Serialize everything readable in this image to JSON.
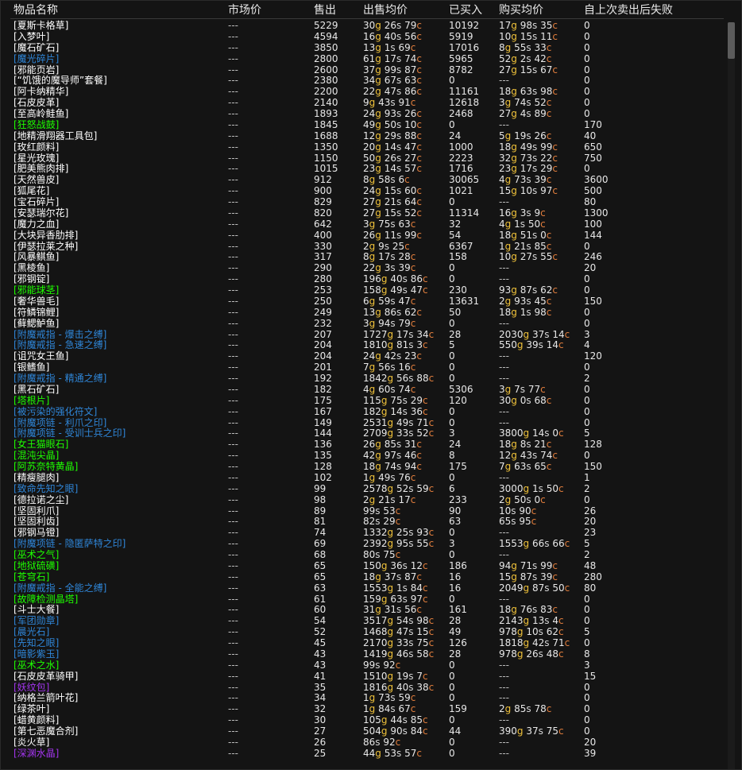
{
  "colors": {
    "white": "#ffffff",
    "blue": "#2f86d8",
    "green": "#1eff00",
    "purple": "#a335ee",
    "gold": "#f0c23a",
    "silver": "#d6d6d6",
    "copper": "#e07d3c"
  },
  "headers": [
    "物品名称",
    "市场价",
    "售出",
    "出售均价",
    "已买入",
    "购买均价",
    "自上次卖出后失败"
  ],
  "rows": [
    {
      "name": "[夏斯卡格草]",
      "q": "white",
      "mkt": "---",
      "sold": "5229",
      "sell": {
        "g": "30",
        "s": "26",
        "c": "79"
      },
      "bought": "10192",
      "buy": {
        "g": "17",
        "s": "98",
        "c": "35"
      },
      "fail": "0"
    },
    {
      "name": "[入梦叶]",
      "q": "white",
      "mkt": "---",
      "sold": "4594",
      "sell": {
        "g": "16",
        "s": "40",
        "c": "56"
      },
      "bought": "5919",
      "buy": {
        "g": "10",
        "s": "15",
        "c": "11"
      },
      "fail": "0"
    },
    {
      "name": "[魔石矿石]",
      "q": "white",
      "mkt": "---",
      "sold": "3850",
      "sell": {
        "g": "13",
        "s": "1",
        "c": "69"
      },
      "bought": "17016",
      "buy": {
        "g": "8",
        "s": "55",
        "c": "33"
      },
      "fail": "0"
    },
    {
      "name": "[魔光碎片]",
      "q": "blue",
      "mkt": "---",
      "sold": "2800",
      "sell": {
        "g": "61",
        "s": "17",
        "c": "74"
      },
      "bought": "5965",
      "buy": {
        "g": "52",
        "s": "2",
        "c": "42"
      },
      "fail": "0"
    },
    {
      "name": "[邪能页岩]",
      "q": "white",
      "mkt": "---",
      "sold": "2600",
      "sell": {
        "g": "37",
        "s": "99",
        "c": "87"
      },
      "bought": "8782",
      "buy": {
        "g": "27",
        "s": "15",
        "c": "67"
      },
      "fail": "0"
    },
    {
      "name": "[“饥饿的魔导师”套餐]",
      "q": "white",
      "mkt": "---",
      "sold": "2380",
      "sell": {
        "g": "34",
        "s": "67",
        "c": "63"
      },
      "bought": "0",
      "buy": null,
      "fail": "0"
    },
    {
      "name": "[阿卡纳精华]",
      "q": "white",
      "mkt": "---",
      "sold": "2200",
      "sell": {
        "g": "22",
        "s": "47",
        "c": "86"
      },
      "bought": "11161",
      "buy": {
        "g": "18",
        "s": "63",
        "c": "98"
      },
      "fail": "0"
    },
    {
      "name": "[石皮皮革]",
      "q": "white",
      "mkt": "---",
      "sold": "2140",
      "sell": {
        "g": "9",
        "s": "43",
        "c": "91"
      },
      "bought": "12618",
      "buy": {
        "g": "3",
        "s": "74",
        "c": "52"
      },
      "fail": "0"
    },
    {
      "name": "[至高岭鲑鱼]",
      "q": "white",
      "mkt": "---",
      "sold": "1893",
      "sell": {
        "g": "24",
        "s": "93",
        "c": "26"
      },
      "bought": "2468",
      "buy": {
        "g": "27",
        "s": "4",
        "c": "89"
      },
      "fail": "0"
    },
    {
      "name": "[狂怒战鼓]",
      "q": "green",
      "mkt": "---",
      "sold": "1845",
      "sell": {
        "g": "49",
        "s": "50",
        "c": "10"
      },
      "bought": "0",
      "buy": null,
      "fail": "170"
    },
    {
      "name": "[地精滑翔器工具包]",
      "q": "white",
      "mkt": "---",
      "sold": "1688",
      "sell": {
        "g": "12",
        "s": "29",
        "c": "88"
      },
      "bought": "24",
      "buy": {
        "g": "5",
        "s": "19",
        "c": "26"
      },
      "fail": "40"
    },
    {
      "name": "[玫红颜料]",
      "q": "white",
      "mkt": "---",
      "sold": "1350",
      "sell": {
        "g": "20",
        "s": "14",
        "c": "47"
      },
      "bought": "1000",
      "buy": {
        "g": "18",
        "s": "49",
        "c": "99"
      },
      "fail": "650"
    },
    {
      "name": "[星光玫瑰]",
      "q": "white",
      "mkt": "---",
      "sold": "1150",
      "sell": {
        "g": "50",
        "s": "26",
        "c": "27"
      },
      "bought": "2223",
      "buy": {
        "g": "32",
        "s": "73",
        "c": "22"
      },
      "fail": "750"
    },
    {
      "name": "[肥美熊肉排]",
      "q": "white",
      "mkt": "---",
      "sold": "1015",
      "sell": {
        "g": "23",
        "s": "14",
        "c": "57"
      },
      "bought": "1716",
      "buy": {
        "g": "23",
        "s": "17",
        "c": "29"
      },
      "fail": "0"
    },
    {
      "name": "[天然兽皮]",
      "q": "white",
      "mkt": "---",
      "sold": "912",
      "sell": {
        "g": "8",
        "s": "58",
        "c": "6"
      },
      "bought": "30065",
      "buy": {
        "g": "4",
        "s": "73",
        "c": "39"
      },
      "fail": "3600"
    },
    {
      "name": "[狐尾花]",
      "q": "white",
      "mkt": "---",
      "sold": "900",
      "sell": {
        "g": "24",
        "s": "15",
        "c": "60"
      },
      "bought": "1021",
      "buy": {
        "g": "15",
        "s": "10",
        "c": "97"
      },
      "fail": "500"
    },
    {
      "name": "[宝石碎片]",
      "q": "white",
      "mkt": "---",
      "sold": "829",
      "sell": {
        "g": "27",
        "s": "21",
        "c": "64"
      },
      "bought": "0",
      "buy": null,
      "fail": "80"
    },
    {
      "name": "[安瑟瑞尔花]",
      "q": "white",
      "mkt": "---",
      "sold": "820",
      "sell": {
        "g": "27",
        "s": "15",
        "c": "52"
      },
      "bought": "11314",
      "buy": {
        "g": "16",
        "s": "3",
        "c": "9"
      },
      "fail": "1300"
    },
    {
      "name": "[魔力之血]",
      "q": "white",
      "mkt": "---",
      "sold": "642",
      "sell": {
        "g": "3",
        "s": "75",
        "c": "63"
      },
      "bought": "32",
      "buy": {
        "g": "4",
        "s": "1",
        "c": "50"
      },
      "fail": "100"
    },
    {
      "name": "[大块异香肋排]",
      "q": "white",
      "mkt": "---",
      "sold": "400",
      "sell": {
        "g": "26",
        "s": "11",
        "c": "99"
      },
      "bought": "54",
      "buy": {
        "g": "18",
        "s": "51",
        "c": "0"
      },
      "fail": "144"
    },
    {
      "name": "[伊瑟拉莱之种]",
      "q": "white",
      "mkt": "---",
      "sold": "330",
      "sell": {
        "g": "2",
        "s": "9",
        "c": "25"
      },
      "bought": "6367",
      "buy": {
        "g": "1",
        "s": "21",
        "c": "85"
      },
      "fail": "0"
    },
    {
      "name": "[风暴鲯鱼]",
      "q": "white",
      "mkt": "---",
      "sold": "317",
      "sell": {
        "g": "8",
        "s": "17",
        "c": "28"
      },
      "bought": "158",
      "buy": {
        "g": "10",
        "s": "27",
        "c": "55"
      },
      "fail": "246"
    },
    {
      "name": "[黑棱鱼]",
      "q": "white",
      "mkt": "---",
      "sold": "290",
      "sell": {
        "g": "22",
        "s": "3",
        "c": "39"
      },
      "bought": "0",
      "buy": null,
      "fail": "20"
    },
    {
      "name": "[邪钢锭]",
      "q": "white",
      "mkt": "---",
      "sold": "280",
      "sell": {
        "g": "196",
        "s": "40",
        "c": "86"
      },
      "bought": "0",
      "buy": null,
      "fail": "0"
    },
    {
      "name": "[邪能球茎]",
      "q": "green",
      "mkt": "---",
      "sold": "253",
      "sell": {
        "g": "158",
        "s": "49",
        "c": "47"
      },
      "bought": "230",
      "buy": {
        "g": "93",
        "s": "87",
        "c": "62"
      },
      "fail": "0"
    },
    {
      "name": "[奢华兽毛]",
      "q": "white",
      "mkt": "---",
      "sold": "250",
      "sell": {
        "g": "6",
        "s": "59",
        "c": "47"
      },
      "bought": "13631",
      "buy": {
        "g": "2",
        "s": "93",
        "c": "45"
      },
      "fail": "150"
    },
    {
      "name": "[符鳞锦鲤]",
      "q": "white",
      "mkt": "---",
      "sold": "249",
      "sell": {
        "g": "13",
        "s": "86",
        "c": "62"
      },
      "bought": "50",
      "buy": {
        "g": "18",
        "s": "1",
        "c": "98"
      },
      "fail": "0"
    },
    {
      "name": "[藓鳃鲈鱼]",
      "q": "white",
      "mkt": "---",
      "sold": "232",
      "sell": {
        "g": "3",
        "s": "94",
        "c": "79"
      },
      "bought": "0",
      "buy": null,
      "fail": "0"
    },
    {
      "name": "[附魔戒指 - 爆击之缚]",
      "q": "blue",
      "mkt": "---",
      "sold": "207",
      "sell": {
        "g": "1727",
        "s": "17",
        "c": "34"
      },
      "bought": "28",
      "buy": {
        "g": "2030",
        "s": "37",
        "c": "14"
      },
      "fail": "3"
    },
    {
      "name": "[附魔戒指 - 急速之缚]",
      "q": "blue",
      "mkt": "---",
      "sold": "204",
      "sell": {
        "g": "1810",
        "s": "81",
        "c": "3"
      },
      "bought": "5",
      "buy": {
        "g": "550",
        "s": "39",
        "c": "14"
      },
      "fail": "4"
    },
    {
      "name": "[诅咒女王鱼]",
      "q": "white",
      "mkt": "---",
      "sold": "204",
      "sell": {
        "g": "24",
        "s": "42",
        "c": "23"
      },
      "bought": "0",
      "buy": null,
      "fail": "120"
    },
    {
      "name": "[银鳍鱼]",
      "q": "white",
      "mkt": "---",
      "sold": "201",
      "sell": {
        "g": "7",
        "s": "56",
        "c": "16"
      },
      "bought": "0",
      "buy": null,
      "fail": "0"
    },
    {
      "name": "[附魔戒指 - 精通之缚]",
      "q": "blue",
      "mkt": "---",
      "sold": "192",
      "sell": {
        "g": "1842",
        "s": "56",
        "c": "88"
      },
      "bought": "0",
      "buy": null,
      "fail": "2"
    },
    {
      "name": "[黑石矿石]",
      "q": "white",
      "mkt": "---",
      "sold": "182",
      "sell": {
        "g": "4",
        "s": "60",
        "c": "74"
      },
      "bought": "5306",
      "buy": {
        "g": "3",
        "s": "7",
        "c": "77"
      },
      "fail": "0"
    },
    {
      "name": "[塔根片]",
      "q": "green",
      "mkt": "---",
      "sold": "175",
      "sell": {
        "g": "115",
        "s": "75",
        "c": "29"
      },
      "bought": "120",
      "buy": {
        "g": "30",
        "s": "0",
        "c": "68"
      },
      "fail": "0"
    },
    {
      "name": "[被污染的强化符文]",
      "q": "blue",
      "mkt": "---",
      "sold": "167",
      "sell": {
        "g": "182",
        "s": "14",
        "c": "36"
      },
      "bought": "0",
      "buy": null,
      "fail": "0"
    },
    {
      "name": "[附魔项链 - 利爪之印]",
      "q": "blue",
      "mkt": "---",
      "sold": "149",
      "sell": {
        "g": "2531",
        "s": "49",
        "c": "71"
      },
      "bought": "0",
      "buy": null,
      "fail": "0"
    },
    {
      "name": "[附魔项链 - 受训士兵之印]",
      "q": "blue",
      "mkt": "---",
      "sold": "144",
      "sell": {
        "g": "2709",
        "s": "33",
        "c": "52"
      },
      "bought": "3",
      "buy": {
        "g": "3800",
        "s": "14",
        "c": "0"
      },
      "fail": "5"
    },
    {
      "name": "[女王猫眼石]",
      "q": "green",
      "mkt": "---",
      "sold": "136",
      "sell": {
        "g": "26",
        "s": "85",
        "c": "31"
      },
      "bought": "24",
      "buy": {
        "g": "18",
        "s": "8",
        "c": "21"
      },
      "fail": "128"
    },
    {
      "name": "[混沌尖晶]",
      "q": "green",
      "mkt": "---",
      "sold": "135",
      "sell": {
        "g": "42",
        "s": "97",
        "c": "46"
      },
      "bought": "8",
      "buy": {
        "g": "12",
        "s": "43",
        "c": "74"
      },
      "fail": "0"
    },
    {
      "name": "[阿苏奈特黄晶]",
      "q": "green",
      "mkt": "---",
      "sold": "128",
      "sell": {
        "g": "18",
        "s": "74",
        "c": "94"
      },
      "bought": "175",
      "buy": {
        "g": "7",
        "s": "63",
        "c": "65"
      },
      "fail": "150"
    },
    {
      "name": "[精瘦腿肉]",
      "q": "white",
      "mkt": "---",
      "sold": "102",
      "sell": {
        "g": "1",
        "s": "49",
        "c": "76"
      },
      "bought": "0",
      "buy": null,
      "fail": "1"
    },
    {
      "name": "[致命先知之眼]",
      "q": "blue",
      "mkt": "---",
      "sold": "99",
      "sell": {
        "g": "2578",
        "s": "52",
        "c": "59"
      },
      "bought": "6",
      "buy": {
        "g": "3000",
        "s": "1",
        "c": "50"
      },
      "fail": "2"
    },
    {
      "name": "[德拉诺之尘]",
      "q": "white",
      "mkt": "---",
      "sold": "98",
      "sell": {
        "g": "2",
        "s": "21",
        "c": "17"
      },
      "bought": "233",
      "buy": {
        "g": "2",
        "s": "50",
        "c": "0"
      },
      "fail": "0"
    },
    {
      "name": "[坚固利爪]",
      "q": "white",
      "mkt": "---",
      "sold": "89",
      "sell": {
        "g": null,
        "s": "99",
        "c": "53"
      },
      "bought": "90",
      "buy": {
        "g": null,
        "s": "10",
        "c": "90"
      },
      "fail": "26"
    },
    {
      "name": "[坚固利齿]",
      "q": "white",
      "mkt": "---",
      "sold": "81",
      "sell": {
        "g": null,
        "s": "82",
        "c": "29"
      },
      "bought": "63",
      "buy": {
        "g": null,
        "s": "65",
        "c": "95"
      },
      "fail": "20"
    },
    {
      "name": "[邪钢马镫]",
      "q": "white",
      "mkt": "---",
      "sold": "74",
      "sell": {
        "g": "1332",
        "s": "25",
        "c": "93"
      },
      "bought": "0",
      "buy": null,
      "fail": "23"
    },
    {
      "name": "[附魔项链 - 隐匿萨特之印]",
      "q": "blue",
      "mkt": "---",
      "sold": "69",
      "sell": {
        "g": "2392",
        "s": "95",
        "c": "55"
      },
      "bought": "3",
      "buy": {
        "g": "1553",
        "s": "66",
        "c": "66"
      },
      "fail": "5"
    },
    {
      "name": "[巫术之气]",
      "q": "green",
      "mkt": "---",
      "sold": "68",
      "sell": {
        "g": null,
        "s": "80",
        "c": "75"
      },
      "bought": "0",
      "buy": null,
      "fail": "2"
    },
    {
      "name": "[地狱硫磺]",
      "q": "green",
      "mkt": "---",
      "sold": "65",
      "sell": {
        "g": "150",
        "s": "36",
        "c": "12"
      },
      "bought": "186",
      "buy": {
        "g": "94",
        "s": "71",
        "c": "99"
      },
      "fail": "48"
    },
    {
      "name": "[苍穹石]",
      "q": "green",
      "mkt": "---",
      "sold": "65",
      "sell": {
        "g": "18",
        "s": "37",
        "c": "87"
      },
      "bought": "16",
      "buy": {
        "g": "15",
        "s": "87",
        "c": "39"
      },
      "fail": "280"
    },
    {
      "name": "[附魔戒指 - 全能之缚]",
      "q": "blue",
      "mkt": "---",
      "sold": "63",
      "sell": {
        "g": "1553",
        "s": "1",
        "c": "84"
      },
      "bought": "16",
      "buy": {
        "g": "2049",
        "s": "87",
        "c": "50"
      },
      "fail": "80"
    },
    {
      "name": "[故障检测晶塔]",
      "q": "green",
      "mkt": "---",
      "sold": "61",
      "sell": {
        "g": "159",
        "s": "63",
        "c": "97"
      },
      "bought": "0",
      "buy": null,
      "fail": "0"
    },
    {
      "name": "[斗士大餐]",
      "q": "white",
      "mkt": "---",
      "sold": "60",
      "sell": {
        "g": "31",
        "s": "31",
        "c": "56"
      },
      "bought": "161",
      "buy": {
        "g": "18",
        "s": "76",
        "c": "83"
      },
      "fail": "0"
    },
    {
      "name": "[军团勋章]",
      "q": "blue",
      "mkt": "---",
      "sold": "54",
      "sell": {
        "g": "3517",
        "s": "54",
        "c": "98"
      },
      "bought": "28",
      "buy": {
        "g": "2143",
        "s": "13",
        "c": "4"
      },
      "fail": "0"
    },
    {
      "name": "[晨光石]",
      "q": "blue",
      "mkt": "---",
      "sold": "52",
      "sell": {
        "g": "1468",
        "s": "47",
        "c": "15"
      },
      "bought": "49",
      "buy": {
        "g": "978",
        "s": "10",
        "c": "62"
      },
      "fail": "5"
    },
    {
      "name": "[先知之眼]",
      "q": "blue",
      "mkt": "---",
      "sold": "45",
      "sell": {
        "g": "2170",
        "s": "33",
        "c": "75"
      },
      "bought": "126",
      "buy": {
        "g": "1818",
        "s": "42",
        "c": "71"
      },
      "fail": "0"
    },
    {
      "name": "[暗影紫玉]",
      "q": "blue",
      "mkt": "---",
      "sold": "43",
      "sell": {
        "g": "1419",
        "s": "46",
        "c": "58"
      },
      "bought": "28",
      "buy": {
        "g": "978",
        "s": "26",
        "c": "48"
      },
      "fail": "8"
    },
    {
      "name": "[巫术之水]",
      "q": "green",
      "mkt": "---",
      "sold": "43",
      "sell": {
        "g": null,
        "s": "99",
        "c": "92"
      },
      "bought": "0",
      "buy": null,
      "fail": "3"
    },
    {
      "name": "[石皮皮革骑甲]",
      "q": "white",
      "mkt": "---",
      "sold": "41",
      "sell": {
        "g": "1510",
        "s": "19",
        "c": "7"
      },
      "bought": "0",
      "buy": null,
      "fail": "15"
    },
    {
      "name": "[妖纹包]",
      "q": "purple",
      "mkt": "---",
      "sold": "35",
      "sell": {
        "g": "1816",
        "s": "40",
        "c": "38"
      },
      "bought": "0",
      "buy": null,
      "fail": "0"
    },
    {
      "name": "[纳格兰箭叶花]",
      "q": "white",
      "mkt": "---",
      "sold": "34",
      "sell": {
        "g": "1",
        "s": "73",
        "c": "59"
      },
      "bought": "0",
      "buy": null,
      "fail": "0"
    },
    {
      "name": "[绿茶叶]",
      "q": "white",
      "mkt": "---",
      "sold": "32",
      "sell": {
        "g": "1",
        "s": "84",
        "c": "67"
      },
      "bought": "159",
      "buy": {
        "g": "2",
        "s": "85",
        "c": "78"
      },
      "fail": "0"
    },
    {
      "name": "[蜡黄颜料]",
      "q": "white",
      "mkt": "---",
      "sold": "30",
      "sell": {
        "g": "105",
        "s": "44",
        "c": "85"
      },
      "bought": "0",
      "buy": null,
      "fail": "0"
    },
    {
      "name": "[第七恶魔合剂]",
      "q": "white",
      "mkt": "---",
      "sold": "27",
      "sell": {
        "g": "504",
        "s": "90",
        "c": "84"
      },
      "bought": "44",
      "buy": {
        "g": "390",
        "s": "37",
        "c": "75"
      },
      "fail": "0"
    },
    {
      "name": "[炎火草]",
      "q": "white",
      "mkt": "---",
      "sold": "26",
      "sell": {
        "g": null,
        "s": "86",
        "c": "92"
      },
      "bought": "0",
      "buy": null,
      "fail": "20"
    },
    {
      "name": "[深渊水晶]",
      "q": "purple",
      "mkt": "---",
      "sold": "25",
      "sell": {
        "g": "44",
        "s": "53",
        "c": "57"
      },
      "bought": "0",
      "buy": null,
      "fail": "39"
    }
  ],
  "buy_none": "---"
}
